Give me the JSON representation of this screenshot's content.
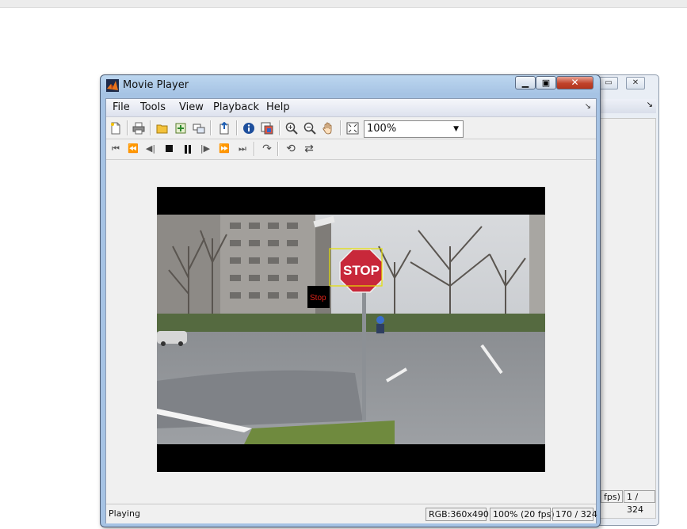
{
  "window": {
    "title": "Movie Player"
  },
  "menu": [
    "File",
    "Tools",
    "View",
    "Playback",
    "Help"
  ],
  "toolbar": {
    "zoom_value": "100%",
    "file_icons": [
      "new-file-icon",
      "print-icon",
      "open-folder-icon",
      "import-icon",
      "connect-icon",
      "export-icon",
      "info-icon",
      "colormap-icon",
      "zoom-in-icon",
      "zoom-out-icon",
      "pan-hand-icon",
      "fit-window-icon"
    ],
    "playback_icons": [
      "go-to-first-icon",
      "rewind-icon",
      "step-back-icon",
      "stop-icon",
      "pause-icon",
      "step-forward-icon",
      "fast-forward-icon",
      "go-to-last-icon",
      "jump-to-icon",
      "loop-icon",
      "playback-direction-icon"
    ]
  },
  "video": {
    "annotation_label": "Stop",
    "sign_text": "STOP",
    "accent_box_color": "#e6e000"
  },
  "status": {
    "state": "Playing",
    "image_info": "RGB:360x490",
    "rate": "100% (20 fps)",
    "frame": "170 / 324"
  },
  "background_window": {
    "status_partial": "fps)",
    "frame": "1 / 324"
  }
}
